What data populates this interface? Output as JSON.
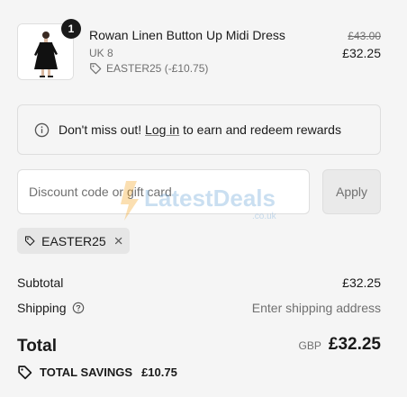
{
  "line_item": {
    "quantity": "1",
    "name": "Rowan Linen Button Up Midi Dress",
    "variant": "UK 8",
    "discount_code_applied": "EASTER25 (-£10.75)",
    "compare_at_price": "£43.00",
    "price": "£32.25",
    "thumbnail_icon": "dress-product-image"
  },
  "rewards_banner": {
    "prefix": "Don't miss out!",
    "link": "Log in",
    "suffix": "to earn and redeem rewards",
    "icon": "info-icon"
  },
  "discount": {
    "placeholder": "Discount code or gift card",
    "apply_label": "Apply",
    "applied_tag": "EASTER25"
  },
  "summary": {
    "subtotal_label": "Subtotal",
    "subtotal_value": "£32.25",
    "shipping_label": "Shipping",
    "shipping_value": "Enter shipping address",
    "total_label": "Total",
    "currency": "GBP",
    "total_value": "£32.25",
    "savings_label": "TOTAL SAVINGS",
    "savings_value": "£10.75"
  },
  "watermark": {
    "text": "LatestDeals",
    "sub": ".co.uk"
  }
}
